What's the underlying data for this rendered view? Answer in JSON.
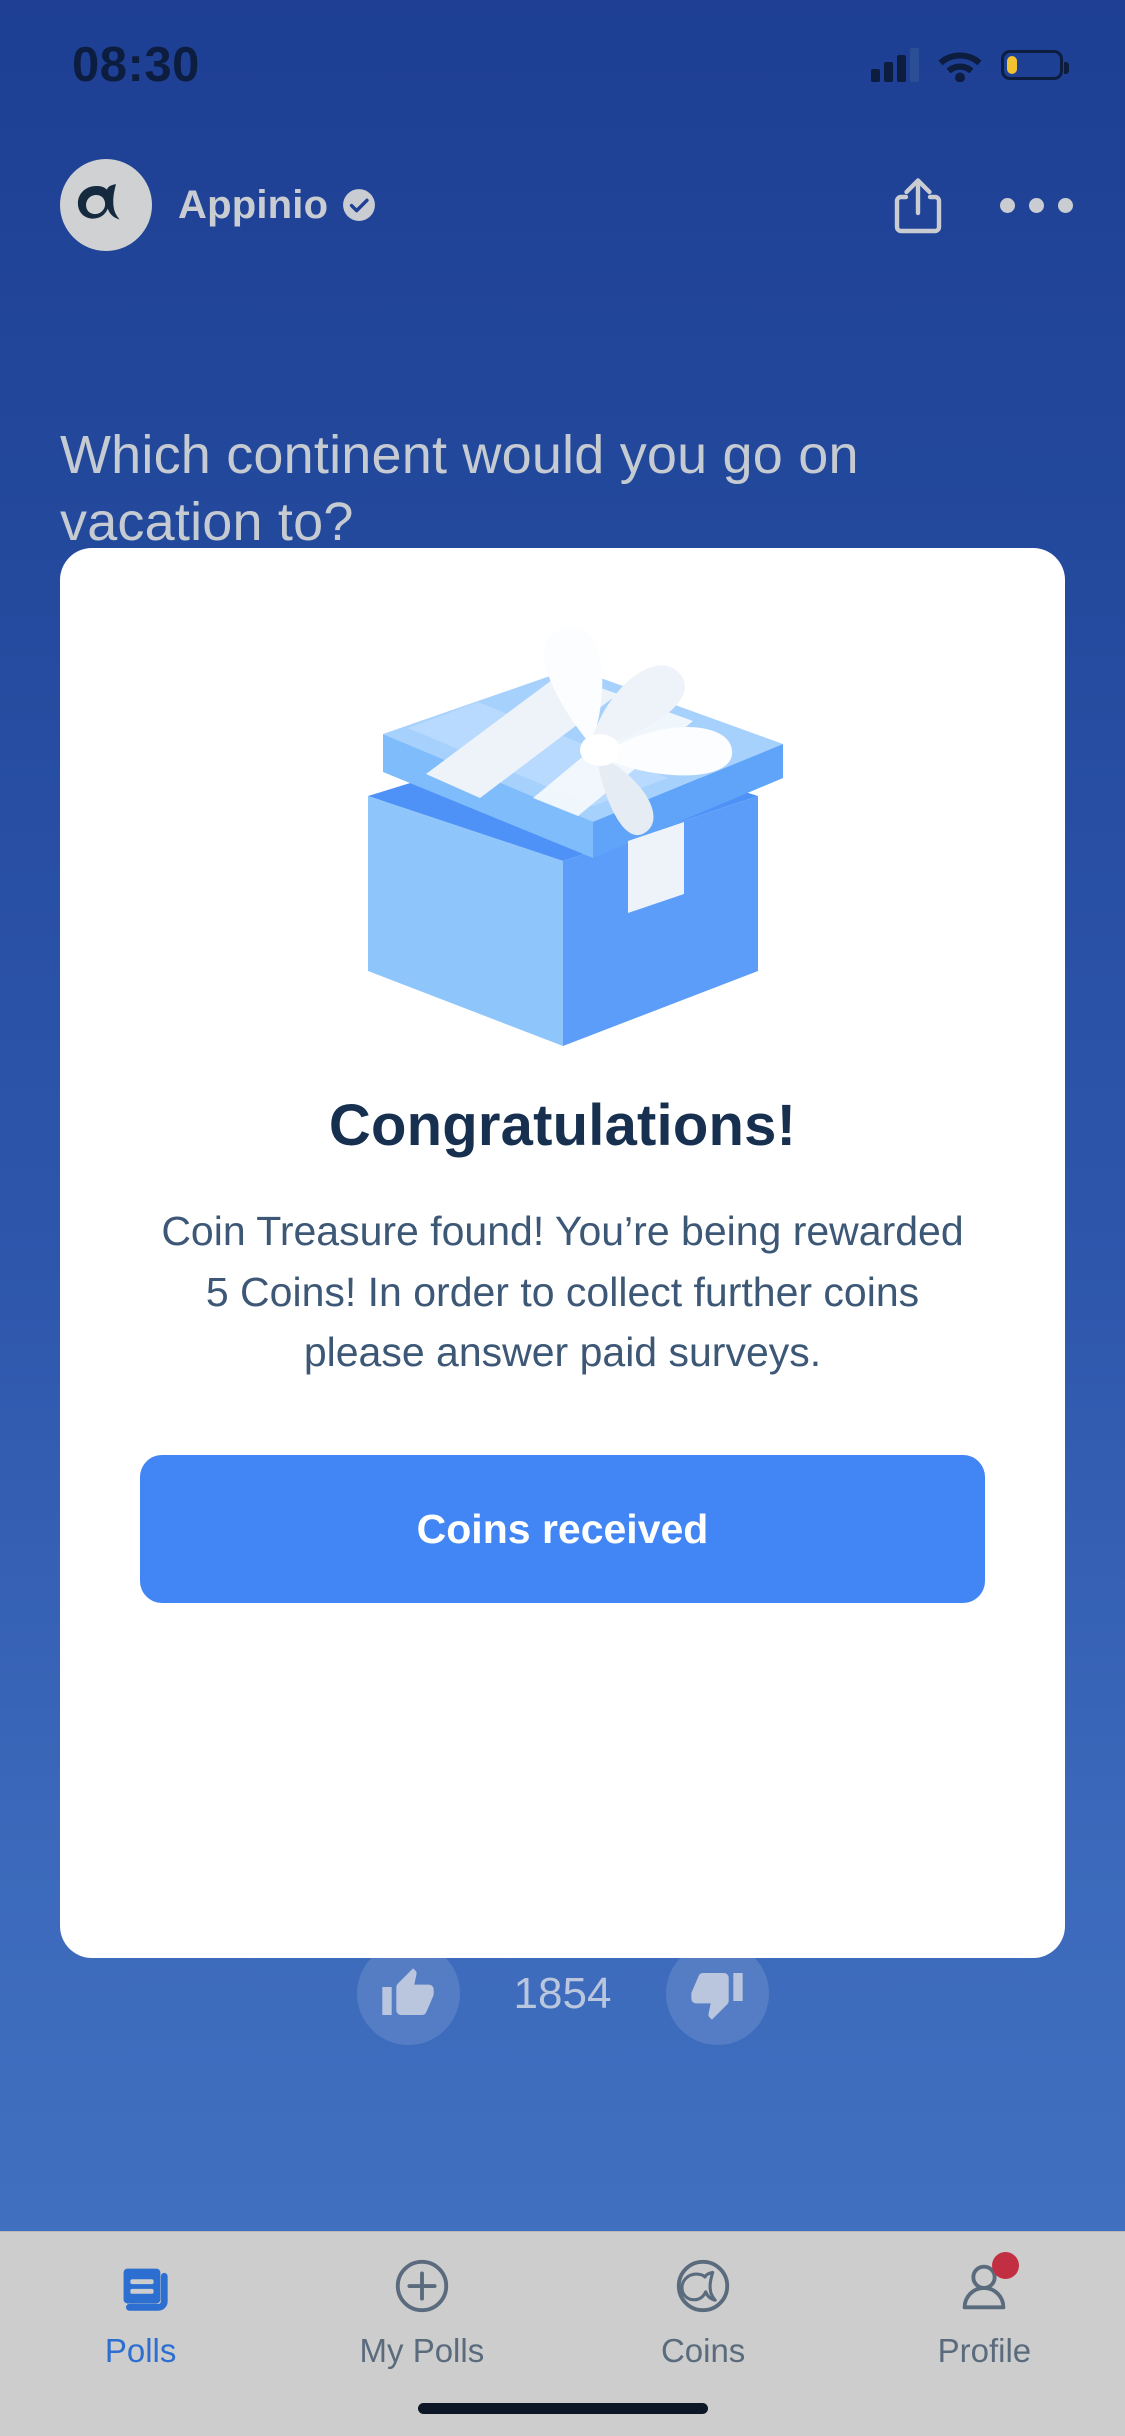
{
  "status_bar": {
    "time": "08:30",
    "signal_icon": "cellular-signal-icon",
    "wifi_icon": "wifi-icon",
    "battery_icon": "battery-low-icon",
    "battery_color": "#f2c230"
  },
  "header": {
    "avatar_icon": "appinio-logo-avatar",
    "brand_name": "Appinio",
    "verified_icon": "verified-check-icon",
    "share_icon": "share-icon",
    "more_icon": "more-options-icon"
  },
  "poll": {
    "question": "Which continent would you go on vacation to?",
    "upvote_icon": "thumbs-up-icon",
    "downvote_icon": "thumbs-down-icon",
    "vote_count": "1854"
  },
  "modal": {
    "illustration_icon": "open-gift-box-icon",
    "title": "Congratulations!",
    "body": "Coin Treasure found! You’re being rewarded 5 Coins! In order to collect further coins please answer paid surveys.",
    "cta_label": "Coins received",
    "cta_color": "#4285f4"
  },
  "tabbar": {
    "items": [
      {
        "label": "Polls",
        "icon": "polls-stack-icon",
        "active": true,
        "badge": false
      },
      {
        "label": "My Polls",
        "icon": "plus-circle-icon",
        "active": false,
        "badge": false
      },
      {
        "label": "Coins",
        "icon": "appinio-coin-icon",
        "active": false,
        "badge": false
      },
      {
        "label": "Profile",
        "icon": "person-icon",
        "active": false,
        "badge": true
      }
    ],
    "active_color": "#2d6fd0",
    "inactive_color": "#5a6b7d",
    "badge_color": "#c32f42"
  },
  "theme": {
    "background_top": "#1e3f93",
    "background_bottom": "#4170c0",
    "card_bg": "#ffffff",
    "title_color": "#17304f",
    "body_color": "#3d5876"
  }
}
